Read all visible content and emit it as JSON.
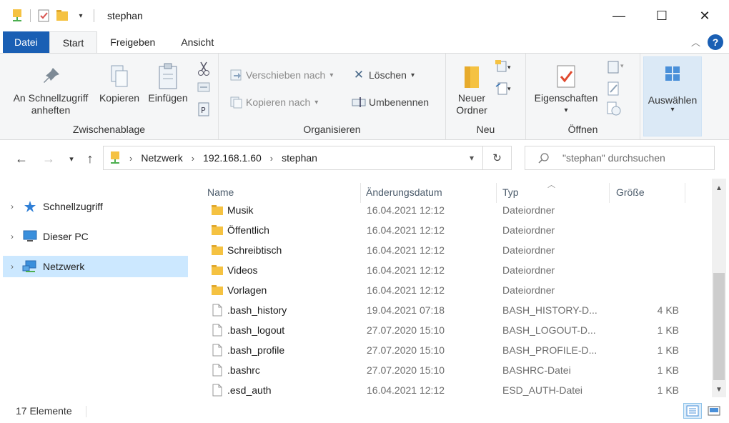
{
  "window": {
    "title": "stephan",
    "minimize_glyph": "—",
    "maximize_glyph": "☐",
    "close_glyph": "✕"
  },
  "ribbon_tabs": [
    {
      "label": "Datei"
    },
    {
      "label": "Start"
    },
    {
      "label": "Freigeben"
    },
    {
      "label": "Ansicht"
    }
  ],
  "ribbon": {
    "clipboard": {
      "pin_label_line1": "An Schnellzugriff",
      "pin_label_line2": "anheften",
      "copy_label": "Kopieren",
      "paste_label": "Einfügen",
      "group_label": "Zwischenablage"
    },
    "organize": {
      "move_label": "Verschieben nach",
      "copy_to_label": "Kopieren nach",
      "delete_label": "Löschen",
      "rename_label": "Umbenennen",
      "group_label": "Organisieren"
    },
    "new": {
      "folder_line1": "Neuer",
      "folder_line2": "Ordner",
      "group_label": "Neu"
    },
    "open": {
      "properties_label": "Eigenschaften",
      "group_label": "Öffnen"
    },
    "select": {
      "label": "Auswählen"
    }
  },
  "address": {
    "crumbs": [
      "Netzwerk",
      "192.168.1.60",
      "stephan"
    ],
    "search_placeholder": "\"stephan\" durchsuchen"
  },
  "nav": [
    {
      "label": "Schnellzugriff"
    },
    {
      "label": "Dieser PC"
    },
    {
      "label": "Netzwerk"
    }
  ],
  "columns": {
    "name": "Name",
    "date": "Änderungsdatum",
    "type": "Typ",
    "size": "Größe"
  },
  "files": [
    {
      "name": "Musik",
      "date": "16.04.2021 12:12",
      "type": "Dateiordner",
      "size": "",
      "kind": "folder"
    },
    {
      "name": "Öffentlich",
      "date": "16.04.2021 12:12",
      "type": "Dateiordner",
      "size": "",
      "kind": "folder"
    },
    {
      "name": "Schreibtisch",
      "date": "16.04.2021 12:12",
      "type": "Dateiordner",
      "size": "",
      "kind": "folder"
    },
    {
      "name": "Videos",
      "date": "16.04.2021 12:12",
      "type": "Dateiordner",
      "size": "",
      "kind": "folder"
    },
    {
      "name": "Vorlagen",
      "date": "16.04.2021 12:12",
      "type": "Dateiordner",
      "size": "",
      "kind": "folder"
    },
    {
      "name": ".bash_history",
      "date": "19.04.2021 07:18",
      "type": "BASH_HISTORY-D...",
      "size": "4 KB",
      "kind": "file"
    },
    {
      "name": ".bash_logout",
      "date": "27.07.2020 15:10",
      "type": "BASH_LOGOUT-D...",
      "size": "1 KB",
      "kind": "file"
    },
    {
      "name": ".bash_profile",
      "date": "27.07.2020 15:10",
      "type": "BASH_PROFILE-D...",
      "size": "1 KB",
      "kind": "file"
    },
    {
      "name": ".bashrc",
      "date": "27.07.2020 15:10",
      "type": "BASHRC-Datei",
      "size": "1 KB",
      "kind": "file"
    },
    {
      "name": ".esd_auth",
      "date": "16.04.2021 12:12",
      "type": "ESD_AUTH-Datei",
      "size": "1 KB",
      "kind": "file"
    }
  ],
  "status": {
    "count": "17 Elemente"
  },
  "colors": {
    "accent": "#1a5fb4",
    "folder": "#f5c242",
    "selection": "#cce8ff"
  }
}
